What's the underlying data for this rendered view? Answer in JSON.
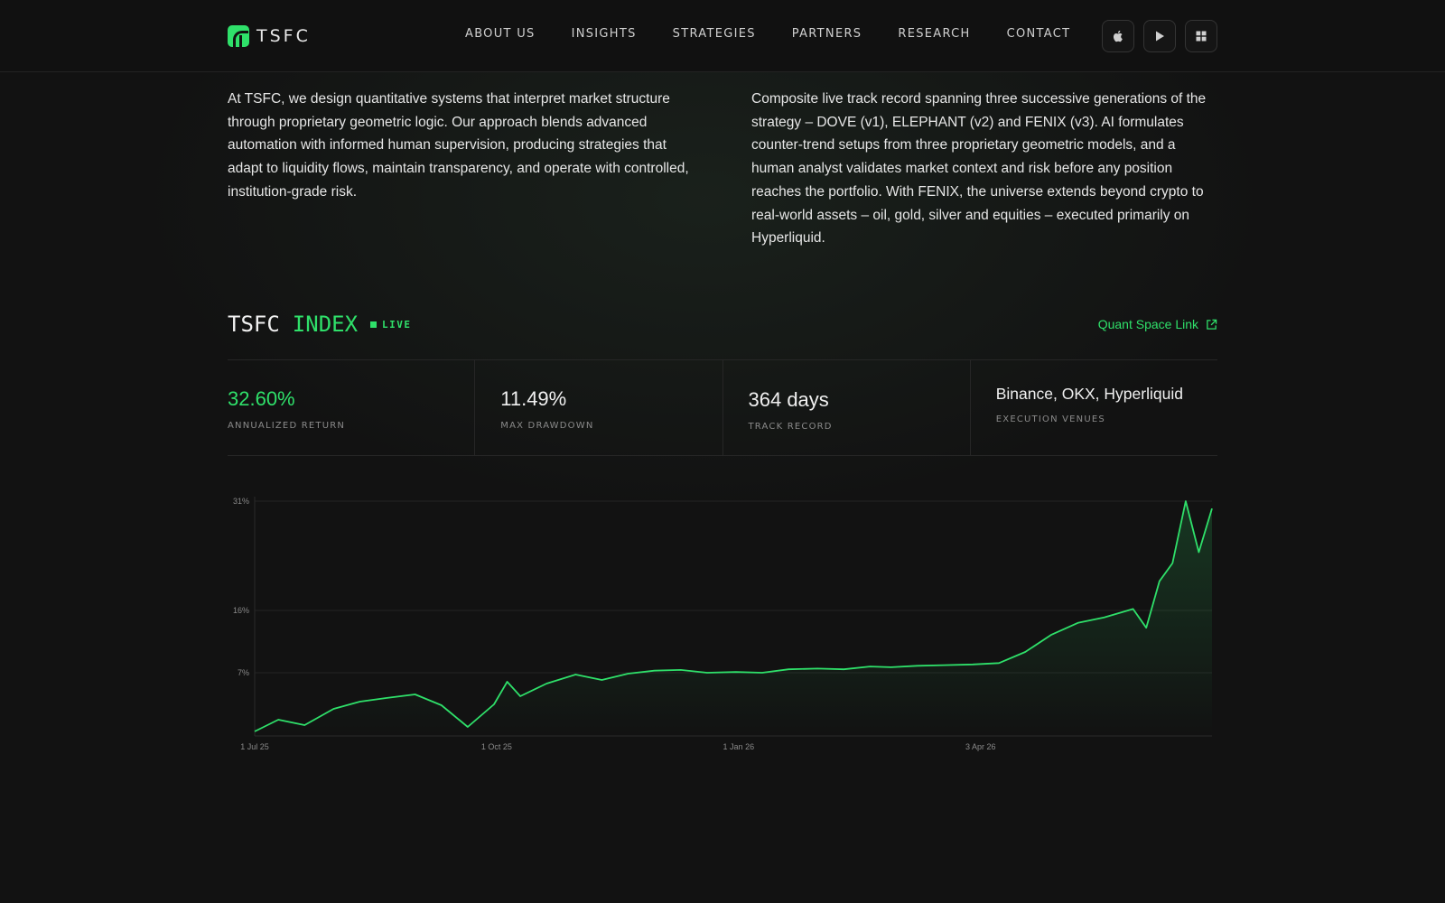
{
  "header": {
    "brand": "TSFC",
    "nav": [
      "ABOUT US",
      "INSIGHTS",
      "STRATEGIES",
      "PARTNERS",
      "RESEARCH",
      "CONTACT"
    ],
    "icons": [
      "apple-icon",
      "play-icon",
      "grid-icon"
    ]
  },
  "intro": {
    "left": "At TSFC, we design quantitative systems that interpret market structure through proprietary geometric logic. Our approach blends advanced automation with informed human supervision, producing strategies that adapt to liquidity flows, maintain transparency, and operate with controlled, institution-grade risk.",
    "right": "Composite live track record spanning three successive generations of the strategy – DOVE (v1), ELEPHANT (v2) and FENIX (v3). AI formulates counter-trend setups from three proprietary geometric models, and a human analyst validates market context and risk before any position reaches the portfolio. With FENIX, the universe extends beyond crypto to real-world assets – oil, gold, silver and equities – executed primarily on Hyperliquid."
  },
  "index": {
    "title_a": "TSFC",
    "title_b": "INDEX",
    "live": "LIVE",
    "link": "Quant Space Link"
  },
  "stats": [
    {
      "value": "32.60%",
      "label": "ANNUALIZED RETURN"
    },
    {
      "value": "11.49%",
      "label": "MAX DRAWDOWN"
    },
    {
      "value": "364 days",
      "label": "TRACK RECORD"
    },
    {
      "value": "Binance, OKX, Hyperliquid",
      "label": "EXECUTION VENUES"
    }
  ],
  "colors": {
    "accent": "#2fe06a",
    "background": "#121212"
  },
  "chart_data": {
    "type": "line",
    "y_ticks": [
      "31%",
      "16%",
      "7%"
    ],
    "x_ticks": [
      "1 Jul 25",
      "1 Oct 25",
      "1 Jan 26",
      "3 Apr 26"
    ],
    "ylim": [
      0,
      31
    ],
    "y_scale": "nonlinear",
    "x_dates": [
      "2025-07-01",
      "2025-07-10",
      "2025-07-20",
      "2025-07-31",
      "2025-08-10",
      "2025-08-20",
      "2025-08-31",
      "2025-09-10",
      "2025-09-20",
      "2025-09-30",
      "2025-10-05",
      "2025-10-10",
      "2025-10-20",
      "2025-10-31",
      "2025-11-10",
      "2025-11-20",
      "2025-11-30",
      "2025-12-10",
      "2025-12-20",
      "2025-12-31",
      "2026-01-10",
      "2026-01-20",
      "2026-01-31",
      "2026-02-10",
      "2026-02-20",
      "2026-02-28",
      "2026-03-10",
      "2026-03-20",
      "2026-03-31",
      "2026-04-10",
      "2026-04-20",
      "2026-04-30",
      "2026-05-10",
      "2026-05-20",
      "2026-05-31",
      "2026-06-05",
      "2026-06-10",
      "2026-06-15",
      "2026-06-20",
      "2026-06-25",
      "2026-06-30"
    ],
    "values": [
      0.5,
      1.8,
      1.2,
      3.0,
      3.8,
      4.2,
      4.6,
      3.4,
      1.0,
      3.5,
      6.0,
      4.4,
      5.8,
      6.8,
      6.2,
      6.9,
      7.3,
      7.4,
      7.0,
      7.1,
      7.0,
      7.5,
      7.6,
      7.5,
      7.9,
      7.8,
      8.0,
      8.1,
      8.2,
      8.4,
      10.0,
      12.5,
      14.2,
      15.0,
      16.2,
      13.5,
      20.0,
      22.5,
      31.0,
      24.0,
      30.0
    ]
  }
}
